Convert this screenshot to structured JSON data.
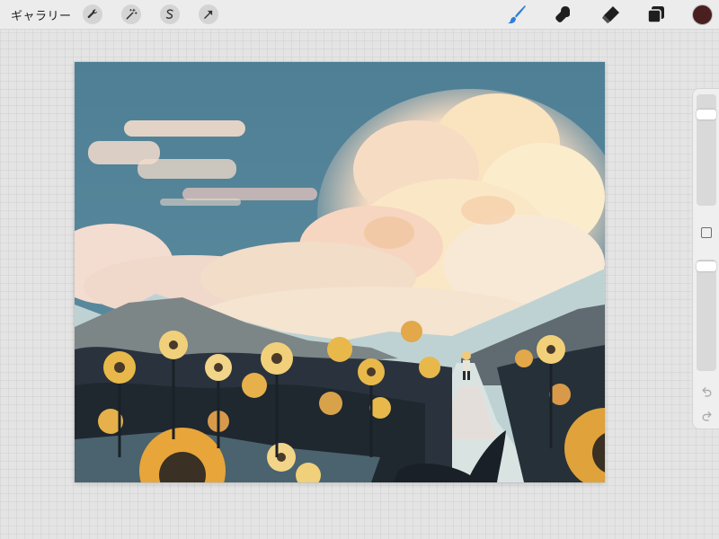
{
  "toolbar": {
    "gallery_label": "ギャラリー",
    "left_tools": [
      "wrench-icon",
      "magic-wand-icon",
      "selection-s-icon",
      "transform-arrow-icon"
    ],
    "right_tools": [
      "brush-icon",
      "smudge-icon",
      "eraser-icon",
      "layers-icon"
    ],
    "active_tool": "brush-icon",
    "active_color": "#4a1f1f",
    "accent_color": "#2f7fd9"
  },
  "sidebar": {
    "brush_size_level": 0.15,
    "brush_opacity_level": 0.02,
    "undo_icon": "undo-arrow-icon",
    "redo_icon": "redo-arrow-icon"
  },
  "canvas": {
    "artwork": "sunflower-field-painting"
  }
}
